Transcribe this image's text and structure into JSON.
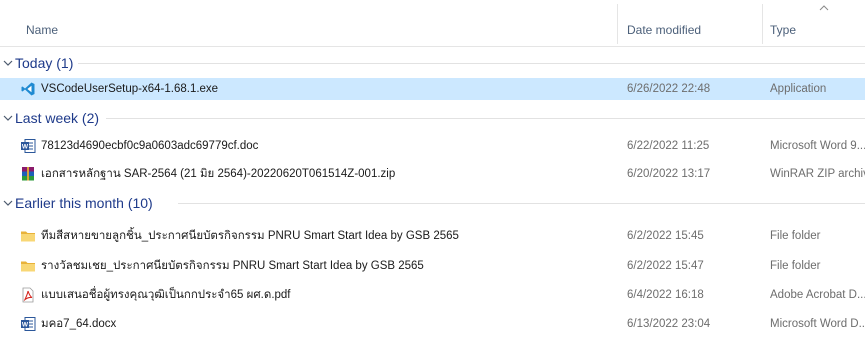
{
  "columns": {
    "name": "Name",
    "date": "Date modified",
    "type": "Type"
  },
  "groups": [
    {
      "title": "Today (1)",
      "items": [
        {
          "name": "VSCodeUserSetup-x64-1.68.1.exe",
          "date": "6/26/2022 22:48",
          "type": "Application",
          "icon": "vscode-icon",
          "selected": true
        }
      ]
    },
    {
      "title": "Last week (2)",
      "items": [
        {
          "name": "78123d4690ecbf0c9a0603adc69779cf.doc",
          "date": "6/22/2022 11:25",
          "type": "Microsoft Word 9...",
          "icon": "word-icon"
        },
        {
          "name": "เอกสารหลักฐาน SAR-2564 (21 มิย 2564)-20220620T061514Z-001.zip",
          "date": "6/20/2022 13:17",
          "type": "WinRAR ZIP archive",
          "icon": "winrar-icon"
        }
      ]
    },
    {
      "title": "Earlier this month (10)",
      "items": [
        {
          "name": "ทีมสีสหายขายลูกชิ้น_ประกาศนียบัตรกิจกรรม PNRU Smart Start Idea by GSB 2565",
          "date": "6/2/2022 15:45",
          "type": "File folder",
          "icon": "folder-icon"
        },
        {
          "name": "รางวัลชมเชย_ประกาศนียบัตรกิจกรรม PNRU Smart Start Idea by GSB 2565",
          "date": "6/2/2022 15:47",
          "type": "File folder",
          "icon": "folder-icon"
        },
        {
          "name": "แบบเสนอชื่อผู้ทรงคุณวุฒิเป็นกกประจำ65 ผศ.ด.pdf",
          "date": "6/4/2022 16:18",
          "type": "Adobe Acrobat D...",
          "icon": "pdf-icon"
        },
        {
          "name": "มคอ7_64.docx",
          "date": "6/13/2022 23:04",
          "type": "Microsoft Word D...",
          "icon": "word-icon"
        }
      ]
    }
  ],
  "colors": {
    "selected": "#cce8ff",
    "group_title": "#1e3a8a",
    "header_text": "#4c607a"
  }
}
